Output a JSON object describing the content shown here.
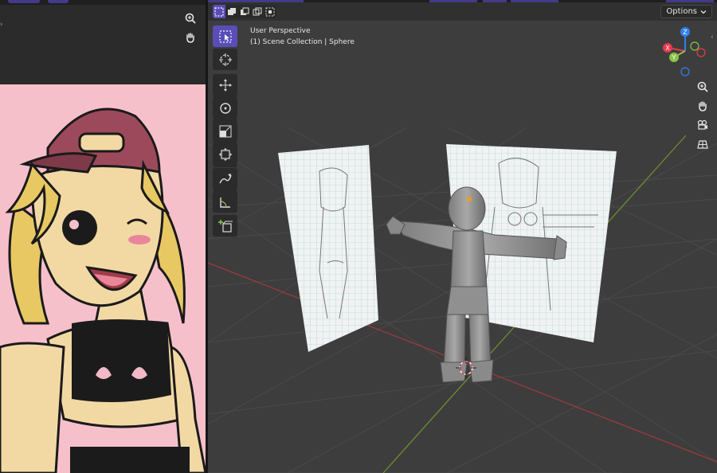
{
  "viewport": {
    "mode_label": "User Perspective",
    "collection_label": "(1) Scene Collection | Sphere",
    "options_label": "Options",
    "options_chevron": "chevron-down"
  },
  "gizmo": {
    "z_label": "Z",
    "x_label": "X",
    "y_label": "Y",
    "colors": {
      "x": "#e53a4e",
      "y": "#8bc34a",
      "z": "#2f80ed"
    }
  },
  "toolbar": {
    "tools": [
      "select-box",
      "cursor",
      "move",
      "rotate",
      "scale",
      "transform",
      "annotate",
      "measure",
      "add-cube"
    ]
  },
  "image_editor": {
    "nav_tools": [
      "zoom",
      "pan"
    ]
  },
  "view_nav": {
    "tools": [
      "zoom",
      "pan",
      "camera",
      "grid-toggle"
    ]
  },
  "colors": {
    "accent": "#5a4db8",
    "viewport_bg": "#3d3d3d",
    "panel_bg": "#2b2b2b",
    "reference_bg": "#f6c0cb"
  }
}
